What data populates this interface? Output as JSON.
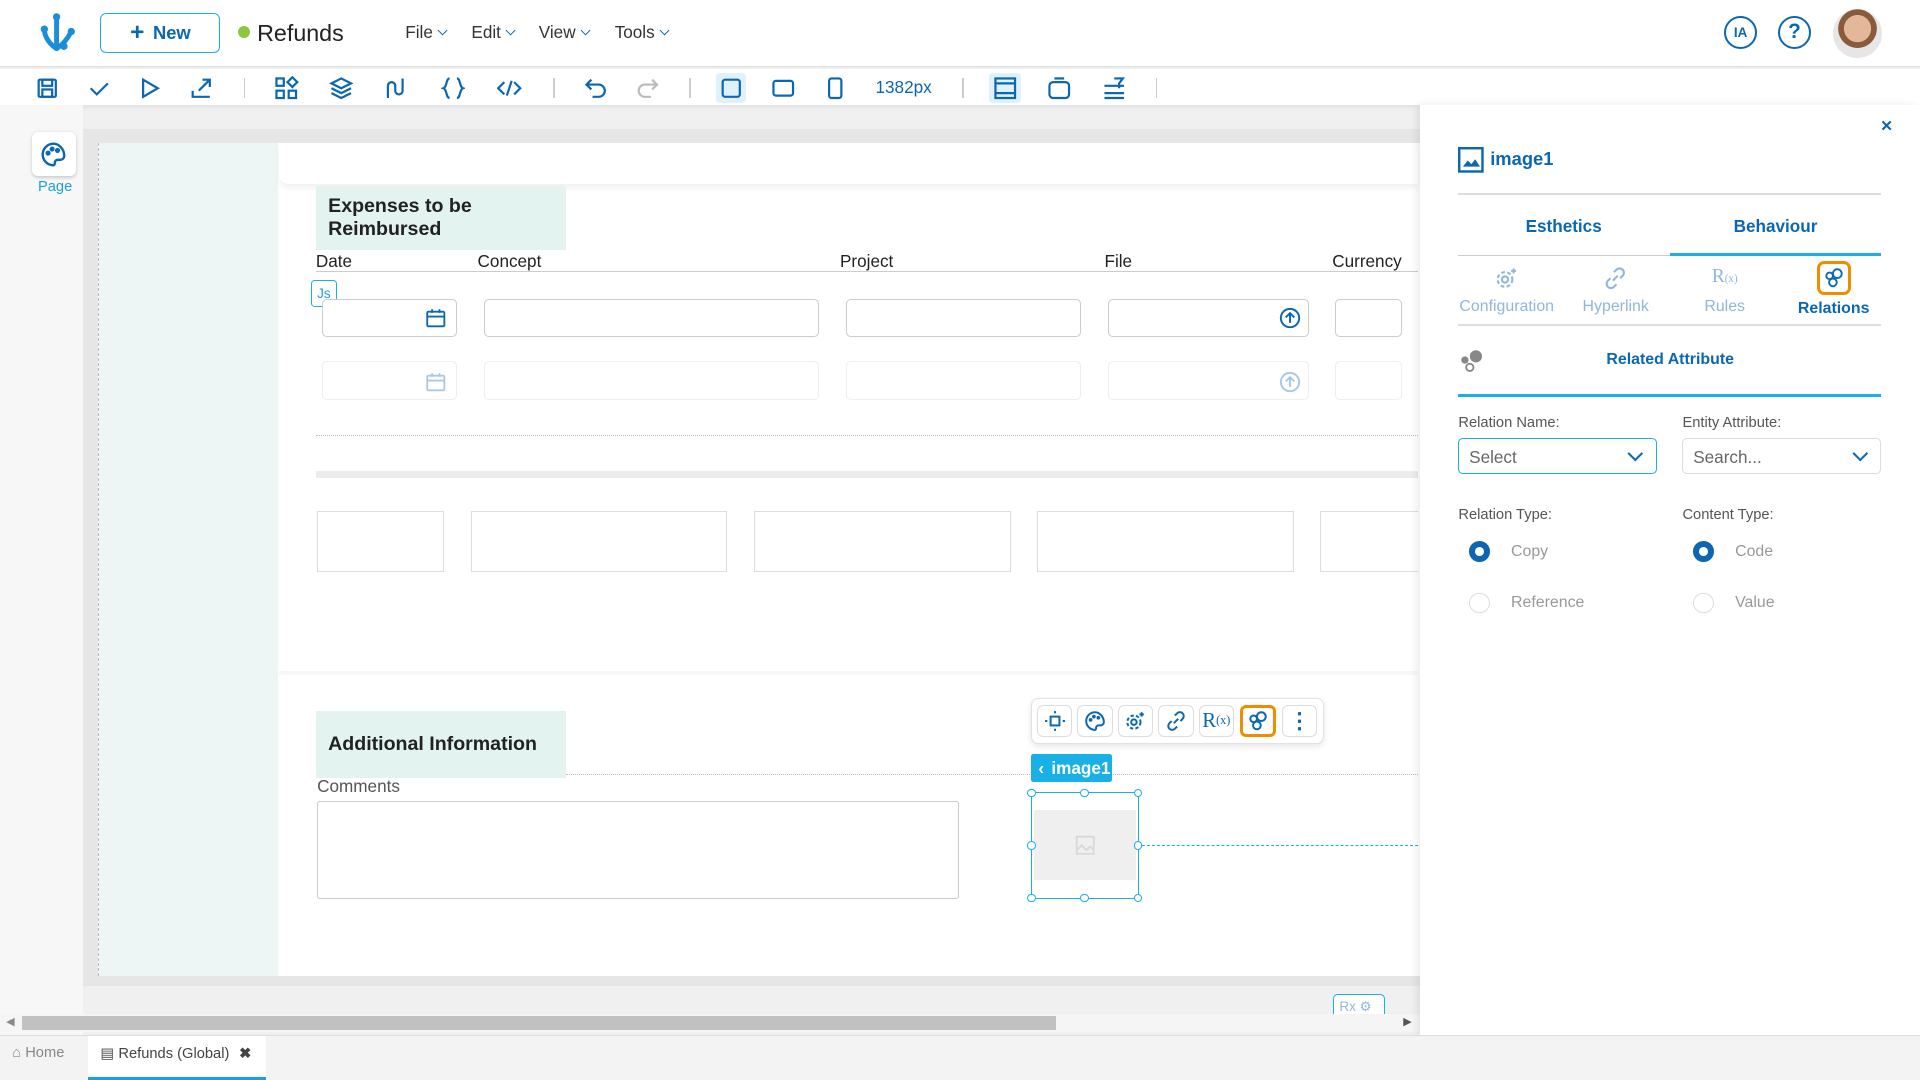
{
  "header": {
    "new_label": "New",
    "app_title": "Refunds",
    "status_color": "#8dc63f",
    "menus": [
      "File",
      "Edit",
      "View",
      "Tools"
    ],
    "ia_label": "IA"
  },
  "toolbar": {
    "width_value": "1382px",
    "icons": [
      "save-icon",
      "check-icon",
      "run-icon",
      "export-icon",
      "components-icon",
      "layers-icon",
      "flow-icon",
      "braces-icon",
      "code-icon",
      "undo-icon",
      "redo-icon",
      "desktop-icon",
      "tablet-icon",
      "mobile-icon",
      "layout-icon",
      "frame-icon",
      "filter-icon"
    ]
  },
  "left_rail": {
    "page_label": "Page"
  },
  "canvas": {
    "section1": {
      "title": "Expenses to be Reimbursed",
      "columns": [
        "Date",
        "Concept",
        "Project",
        "File",
        "Currency"
      ],
      "js_badge": "Js"
    },
    "section2": {
      "title": "Additional Information",
      "comments_label": "Comments"
    },
    "selected_tag": "image1",
    "rx_label": "Rx"
  },
  "panel": {
    "title": "image1",
    "tabs": [
      "Esthetics",
      "Behaviour"
    ],
    "active_tab": "Behaviour",
    "subtabs": [
      "Configuration",
      "Hyperlink",
      "Rules",
      "Relations"
    ],
    "active_subtab": "Relations",
    "section_title": "Related Attribute",
    "relation_name_label": "Relation Name:",
    "relation_name_value": "Select",
    "entity_attribute_label": "Entity Attribute:",
    "entity_attribute_placeholder": "Search...",
    "relation_type_label": "Relation Type:",
    "relation_types": [
      "Copy",
      "Reference"
    ],
    "relation_type_selected": "Copy",
    "content_type_label": "Content Type:",
    "content_types": [
      "Code",
      "Value"
    ],
    "content_type_selected": "Code"
  },
  "bottom_tabs": [
    {
      "label": "Home"
    },
    {
      "label": "Refunds (Global)",
      "active": true
    }
  ],
  "colors": {
    "primary": "#0b67b2",
    "accent": "#19b0e8",
    "highlight": "#f08c00"
  }
}
